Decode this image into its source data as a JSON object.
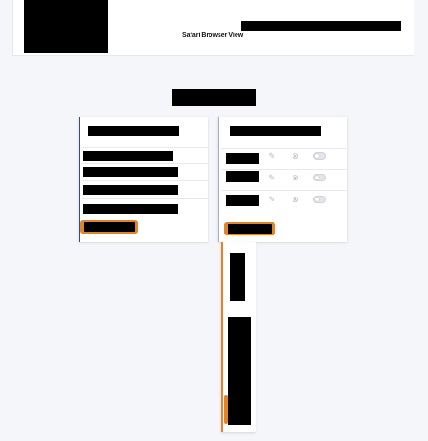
{
  "header": {
    "title": "Safari Browser View"
  },
  "cards": {
    "left": {
      "row_count": 4
    },
    "right": {
      "row_count": 3
    }
  },
  "row_actions": [
    "edit-icon",
    "delete-icon",
    "toggle-switch"
  ],
  "colors": {
    "accent_orange": "#e0852a",
    "accent_blue": "#2f4f86",
    "page_background": "#f5f6fa",
    "card_background": "#ffffff"
  }
}
